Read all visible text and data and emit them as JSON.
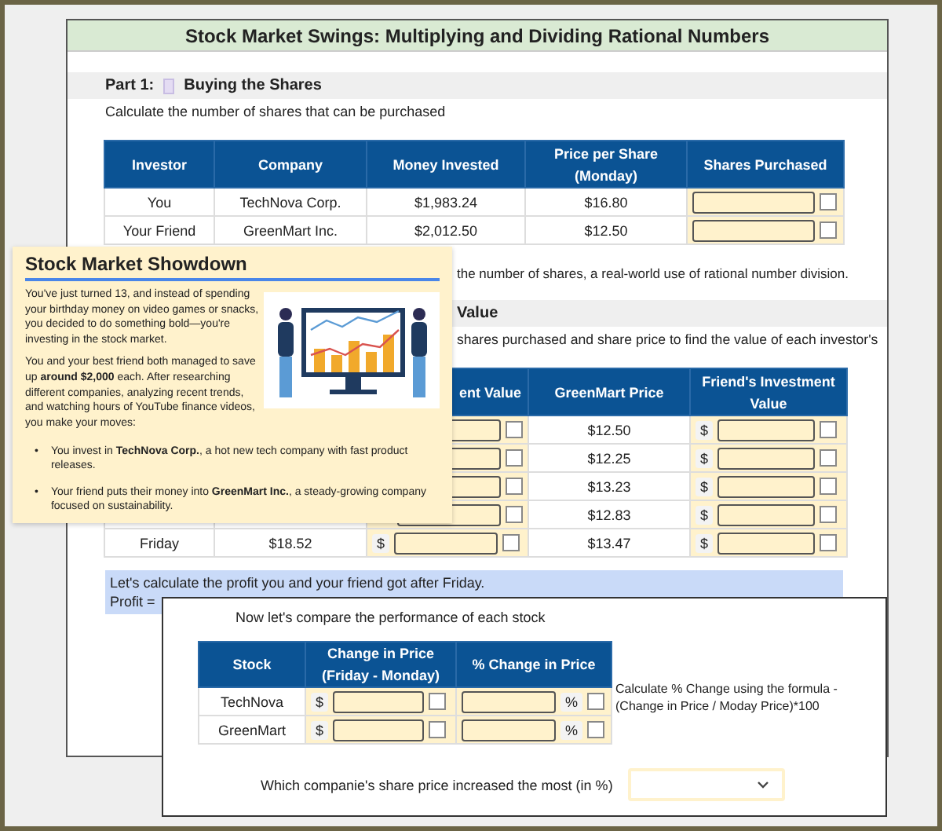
{
  "title": "Stock Market Swings: Multiplying and Dividing Rational Numbers",
  "part1": {
    "label": "Part 1:",
    "heading": "Buying the Shares",
    "instruction": "Calculate the number of shares that can be purchased",
    "columns": [
      "Investor",
      "Company",
      "Money Invested",
      "Price per Share (Monday)",
      "Shares Purchased"
    ],
    "rows": [
      {
        "investor": "You",
        "company": "TechNova Corp.",
        "money": "$1,983.24",
        "price": "$16.80",
        "checked": false
      },
      {
        "investor": "Your Friend",
        "company": "GreenMart Inc.",
        "money": "$2,012.50",
        "price": "$12.50",
        "checked": false
      }
    ],
    "note": "the number of shares, a real-world use of rational number division."
  },
  "part2": {
    "heading": "Value",
    "instruction": "shares purchased and share price to find the value of each investor's",
    "columns": [
      "ent Value",
      "GreenMart Price",
      "Friend's Investment Value"
    ],
    "rows": [
      {
        "greenmart_price": "$12.50",
        "friend_currency": "$",
        "your_checked": false,
        "friend_checked": false
      },
      {
        "greenmart_price": "$12.25",
        "friend_currency": "$",
        "your_checked": false,
        "friend_checked": false
      },
      {
        "greenmart_price": "$13.23",
        "friend_currency": "$",
        "your_checked": false,
        "friend_checked": false
      },
      {
        "greenmart_price": "$12.83",
        "friend_currency": "$",
        "your_checked": false,
        "friend_checked": false
      },
      {
        "day": "Friday",
        "technova_price": "$18.52",
        "your_currency": "$",
        "greenmart_price": "$13.47",
        "friend_currency": "$",
        "your_checked": false,
        "friend_checked": false
      }
    ]
  },
  "profit": {
    "lines": [
      "Let's calculate the profit you and your friend got after Friday.",
      "Profit ="
    ]
  },
  "callout": {
    "title": "Stock Market Showdown",
    "paragraphs": [
      "You've just turned 13, and instead of spending your birthday money on video games or snacks, you decided to do something bold—you're investing in the stock market.",
      "You and your best friend both managed to save up **around $2,000** each. After researching different companies, analyzing recent trends, and watching hours of YouTube finance videos, you make your moves:"
    ],
    "marker": "•",
    "bullets": [
      "You invest in **TechNova Corp.**, a hot new tech company with fast product releases.",
      "Your friend puts their money into **GreenMart Inc.**, a steady-growing company focused on sustainability."
    ]
  },
  "comparison": {
    "intro": "Now let's compare the performance of each stock",
    "columns": [
      "Stock",
      "Change in Price (Friday - Monday)",
      "% Change in Price"
    ],
    "rows": [
      {
        "stock": "TechNova",
        "currency": "$",
        "percent": "%",
        "change_checked": false,
        "pct_checked": false
      },
      {
        "stock": "GreenMart",
        "currency": "$",
        "percent": "%",
        "change_checked": false,
        "pct_checked": false
      }
    ],
    "formula_note": "Calculate % Change using the formula - (Change in Price / Moday Price)*100",
    "question": "Which companie's share price increased the most (in %)"
  }
}
